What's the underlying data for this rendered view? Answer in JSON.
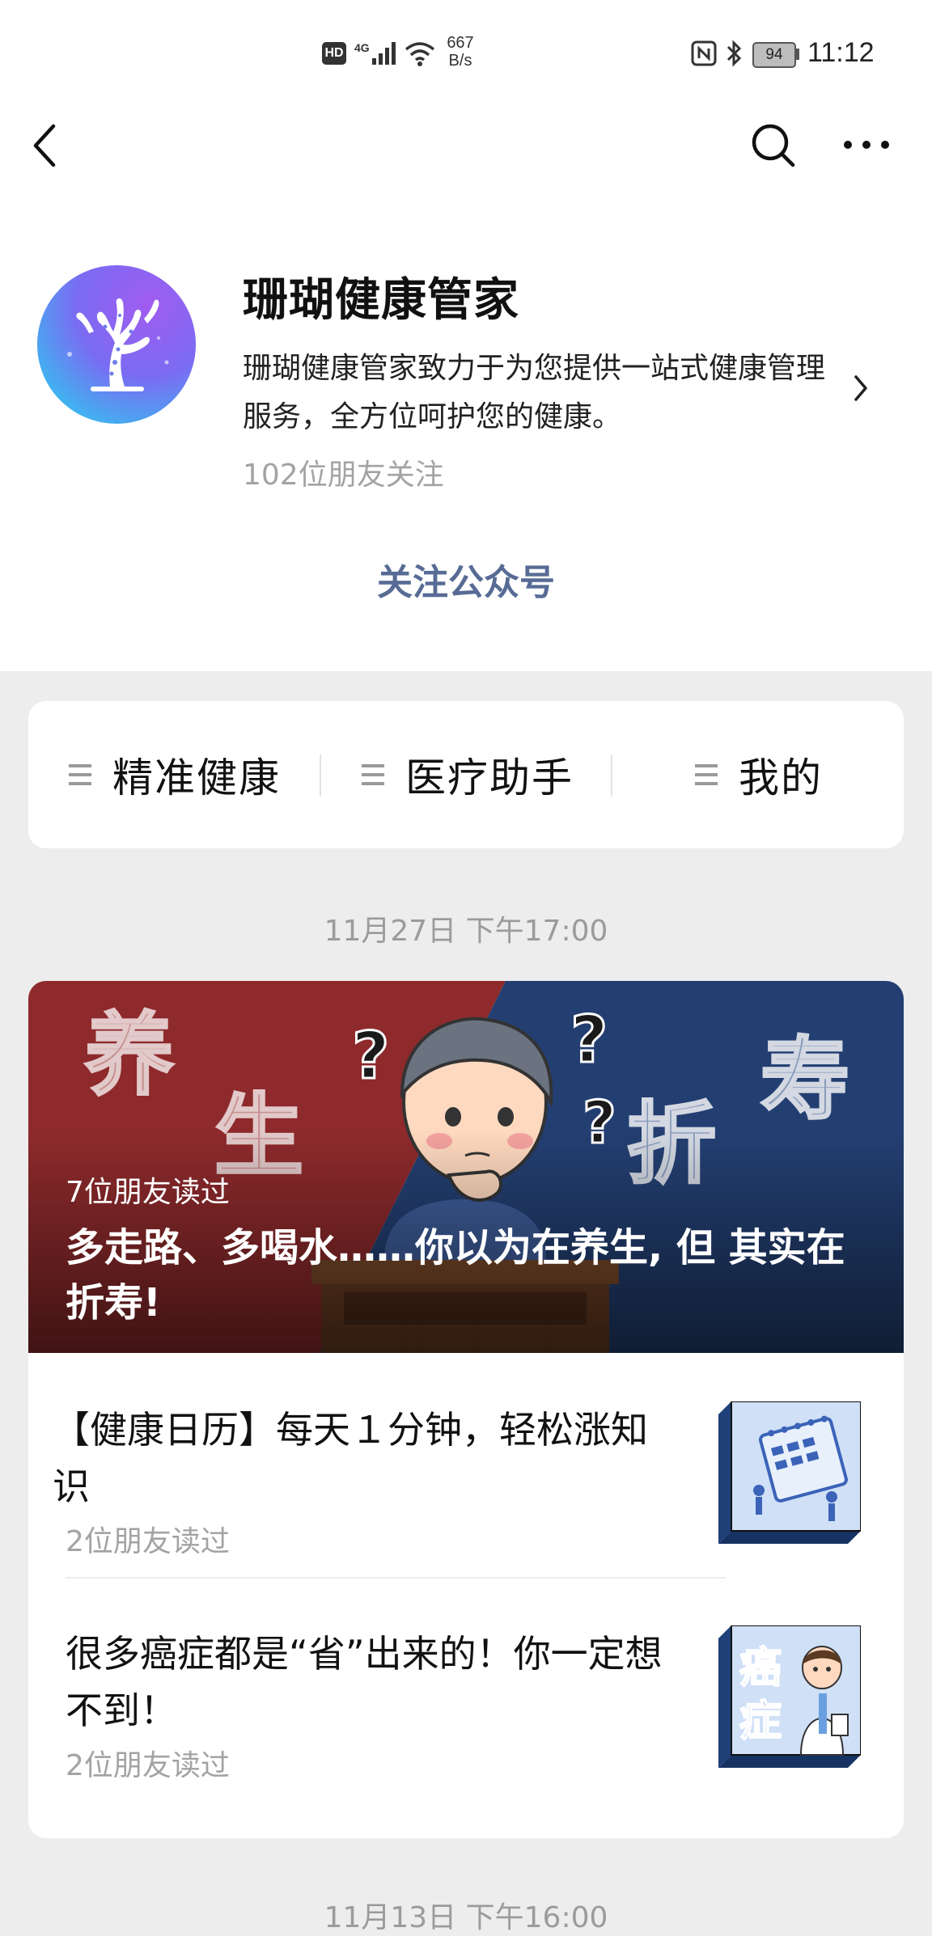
{
  "status_bar": {
    "hd": "HD",
    "network": "4G",
    "speed_value": "667",
    "speed_unit": "B/s",
    "battery": "94",
    "time": "11:12"
  },
  "nav": {
    "back_icon": "chevron-left-icon",
    "search_icon": "search-icon",
    "more_icon": "more-icon"
  },
  "account": {
    "name": "珊瑚健康管家",
    "description": "珊瑚健康管家致力于为您提供一站式健康管理服务，全方位呵护您的健康。",
    "followers": "102位朋友关注",
    "follow_button": "关注公众号"
  },
  "menu": {
    "items": [
      {
        "label": "精准健康"
      },
      {
        "label": "医疗助手"
      },
      {
        "label": "我的"
      }
    ]
  },
  "feed": {
    "date_1": "11月27日 下午17:00",
    "hero": {
      "reads": "7位朋友读过",
      "title": "多走路、多喝水……你以为在养生, 但 其实在折寿!",
      "art_text": [
        "养",
        "生",
        "折",
        "寿"
      ]
    },
    "items": [
      {
        "title": "【健康日历】每天１分钟，轻松涨知识",
        "reads": "2位朋友读过"
      },
      {
        "title": "很多癌症都是“省”出来的！你一定想不到！",
        "reads": "2位朋友读过",
        "thumb_text": [
          "癌",
          "症"
        ]
      }
    ],
    "date_2": "11月13日 下午16:00"
  },
  "colors": {
    "link_blue": "#576b95",
    "bg_gray": "#ededed",
    "hero_red": "#8e2a2c",
    "hero_navy": "#233f72"
  }
}
